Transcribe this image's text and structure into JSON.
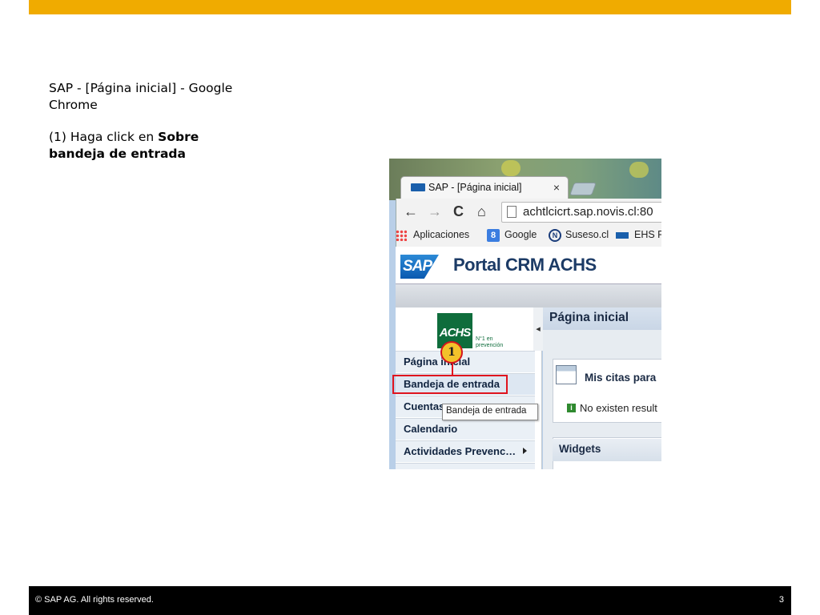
{
  "colors": {
    "topbar": "#f0ab00",
    "footer": "#000000",
    "highlight": "#e0141e",
    "marker": "#f3c22a"
  },
  "slide": {
    "title": "SAP - [Página inicial] - Google Chrome",
    "instruction_prefix": "(1) Haga click en ",
    "instruction_bold": "Sobre bandeja de entrada"
  },
  "footer": {
    "copyright": "©  SAP AG. All rights reserved.",
    "page_number": "3"
  },
  "screenshot": {
    "tab_title": "SAP - [Página inicial]",
    "tab_close": "×",
    "nav": {
      "back": "←",
      "forward": "→",
      "reload": "C",
      "home": "⌂"
    },
    "url": "achtlcicrt.sap.novis.cl:80",
    "bookmarks": [
      {
        "label": "Aplicaciones",
        "icon": "apps-grid-icon"
      },
      {
        "label": "Google",
        "icon": "google-icon"
      },
      {
        "label": "Suseso.cl",
        "icon": "suseso-icon"
      },
      {
        "label": "EHS P",
        "icon": "sap-icon"
      }
    ],
    "sap_logo": "SAP",
    "portal_title": "Portal CRM ACHS",
    "achs_logo": "ACHS",
    "achs_tagline": "N°1 en prevención",
    "collapse_arrow": "◂",
    "menu": [
      {
        "label": "Página inicial"
      },
      {
        "label": "Bandeja de entrada"
      },
      {
        "label": "Cuentas"
      },
      {
        "label": "Calendario"
      },
      {
        "label": "Actividades Prevenc…"
      }
    ],
    "marker_number": "1",
    "tooltip": "Bandeja de entrada",
    "page_title": "Página inicial",
    "citas_title": "Mis citas para",
    "info_icon": "i",
    "no_results": "No existen result",
    "widgets_title": "Widgets"
  }
}
